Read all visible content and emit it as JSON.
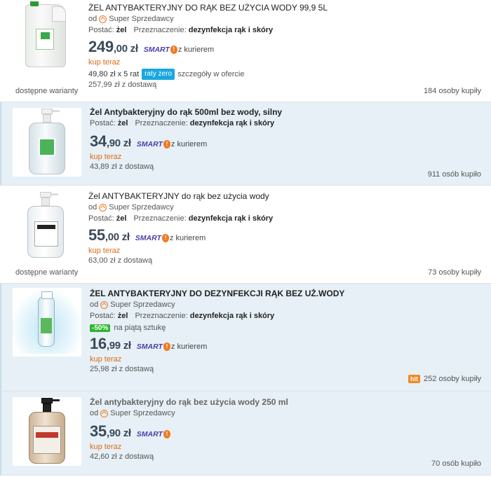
{
  "items": [
    {
      "title": "ŻEL ANTYBAKTERYJNY DO RĄK BEZ UŻYCIA WODY 99,9 5L",
      "seller_prefix": "od",
      "seller": "Super Sprzedawcy",
      "state_label": "Postać:",
      "state_value": "żel",
      "purpose_label": "Przeznaczenie:",
      "purpose_value": "dezynfekcja rąk i skóry",
      "price_main": "249",
      "price_cents": ",00 zł",
      "smart": "SMART",
      "smart_courier": "z kurierem",
      "buy": "kup teraz",
      "installment": "49,80 zł x 5 rat",
      "installment_badge": "raty zero",
      "installment_details": "szczegóły w ofercie",
      "shipping": "257,99 zł z dostawą",
      "variants": "dostępne warianty",
      "buyers": "184 osoby kupiły",
      "image": "canister-image"
    },
    {
      "title": "Żel Antybakteryjny do rąk 500ml bez wody, silny",
      "state_label": "Postać:",
      "state_value": "żel",
      "purpose_label": "Przeznaczenie:",
      "purpose_value": "dezynfekcja rąk i skóry",
      "price_main": "34",
      "price_cents": ",90 zł",
      "smart": "SMART",
      "smart_courier": "z kurierem",
      "buy": "kup teraz",
      "shipping": "43,89 zł z dostawą",
      "buyers": "911 osób kupiło",
      "image": "pump-bottle-image"
    },
    {
      "title": "Żel ANTYBAKTERYJNY do rąk bez użycia wody",
      "seller_prefix": "od",
      "seller": "Super Sprzedawcy",
      "state_label": "Postać:",
      "state_value": "żel",
      "purpose_label": "Przeznaczenie:",
      "purpose_value": "dezynfekcja rąk i skóry",
      "price_main": "55",
      "price_cents": ",00 zł",
      "smart": "SMART",
      "smart_courier": "z kurierem",
      "buy": "kup teraz",
      "shipping": "63,00 zł z dostawą",
      "variants": "dostępne warianty",
      "buyers": "73 osoby kupiły",
      "image": "clear-pump-bottle-image"
    },
    {
      "title": "ŻEL ANTYBAKTERYJNY DO DEZYNFEKCJI RĄK BEZ UŻ.WODY",
      "seller_prefix": "od",
      "seller": "Super Sprzedawcy",
      "state_label": "Postać:",
      "state_value": "żel",
      "purpose_label": "Przeznaczenie:",
      "purpose_value": "dezynfekcja rąk i skóry",
      "promo_badge": "-50%",
      "promo_text": "na piątą sztukę",
      "price_main": "16",
      "price_cents": ",99 zł",
      "smart": "SMART",
      "smart_courier": "z kurierem",
      "buy": "kup teraz",
      "shipping": "25,98 zł z dostawą",
      "hit": "hit",
      "buyers": "252 osoby kupiły",
      "image": "splash-bottle-image"
    },
    {
      "title": "Żel antybakteryjny do rąk bez użycia wody 250 ml",
      "seller_prefix": "od",
      "seller": "Super Sprzedawcy",
      "price_main": "35",
      "price_cents": ",90 zł",
      "smart": "SMART",
      "buy": "kup teraz",
      "shipping": "42,60 zł z dostawą",
      "buyers": "70 osób kupiło",
      "image": "black-pump-bottle-image"
    }
  ],
  "smart_badge_glyph": "!",
  "colors": {
    "price": "#3b4a5a",
    "buy": "#e06a14",
    "smart": "#4a3ea8",
    "highlight_bg": "#e6f0f6",
    "promo_green": "#2fb52f",
    "raty_blue": "#1aa7e0",
    "hit_orange": "#f08a24"
  }
}
